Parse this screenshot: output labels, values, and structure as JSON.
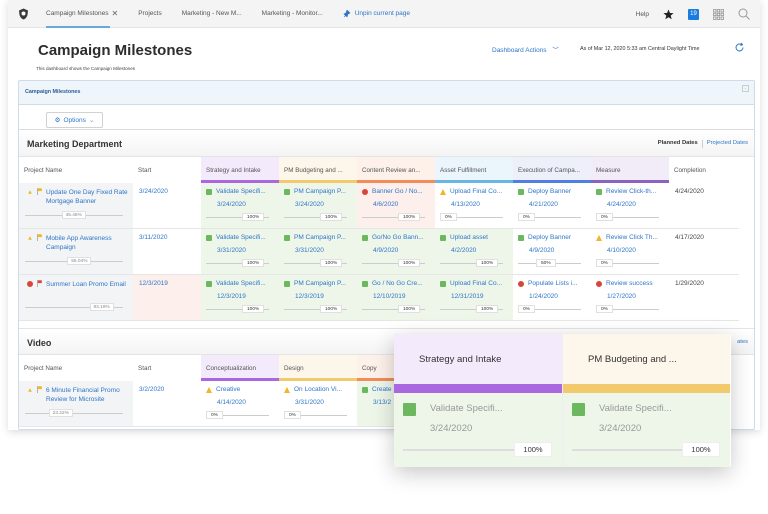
{
  "topbar": {
    "tabs": [
      {
        "label": "Campaign Milestones",
        "active": true,
        "closable": true
      },
      {
        "label": "Projects"
      },
      {
        "label": "Marketing - New M..."
      },
      {
        "label": "Marketing - Monitor..."
      }
    ],
    "unpin_label": "Unpin current page",
    "help_label": "Help",
    "notification_count": "19",
    "icons": [
      "logo-icon",
      "pin-icon",
      "star-icon",
      "apps-grid-icon",
      "search-icon"
    ]
  },
  "header": {
    "title": "Campaign Milestones",
    "subtitle": "This dashboard shows the Campaign Milestones",
    "dashboard_actions": "Dashboard Actions",
    "as_of": "As of  Mar 12, 2020 5:33 am Central Daylight Time"
  },
  "panel": {
    "title": "Campaign Milestones",
    "options_label": "Options"
  },
  "marketing": {
    "title": "Marketing Department",
    "planned_dates": "Planned Dates",
    "projected_dates": "Projected Dates",
    "columns": [
      {
        "label": "Project Name"
      },
      {
        "label": "Start"
      },
      {
        "label": "Strategy and Intake",
        "bg": "#f3eafb",
        "bar": "#a968e0"
      },
      {
        "label": "PM Budgeting and ...",
        "bg": "#fdf6ea",
        "bar": "#f2c96b"
      },
      {
        "label": "Content Review an...",
        "bg": "#fdf1ea",
        "bar": "#f08d58"
      },
      {
        "label": "Asset Fulfillment",
        "bg": "#eaf5fc",
        "bar": "#67b6e4"
      },
      {
        "label": "Execution of Campa...",
        "bg": "#edf0fb",
        "bar": "#4f7fe0"
      },
      {
        "label": "Measure",
        "bg": "#f1ecf7",
        "bar": "#8c62bf"
      },
      {
        "label": "Completion"
      }
    ],
    "rows": [
      {
        "name": "Update One Day Fixed Rate Mortgage Banner",
        "status": "warning",
        "progress": "45.45%",
        "start": "3/24/2020",
        "start_late": false,
        "milestones": [
          {
            "task": "Validate Specifi...",
            "date": "3/24/2020",
            "pct": "100%",
            "status": "done"
          },
          {
            "task": "PM Campaign P...",
            "date": "3/24/2020",
            "pct": "100%",
            "status": "done"
          },
          {
            "task": "Banner Go / No...",
            "date": "4/6/2020",
            "pct": "100%",
            "status": "late"
          },
          {
            "task": "Upload Final Co...",
            "date": "4/13/2020",
            "pct": "0%",
            "status": "warning"
          },
          {
            "task": "Deploy Banner",
            "date": "4/21/2020",
            "pct": "0%",
            "status": "ontrack"
          },
          {
            "task": "Review Click-th...",
            "date": "4/24/2020",
            "pct": "0%",
            "status": "ontrack"
          }
        ],
        "completion": "4/24/2020"
      },
      {
        "name": "Mobile App Awareness Campaign",
        "status": "warning",
        "progress": "55.04%",
        "start": "3/11/2020",
        "start_late": false,
        "milestones": [
          {
            "task": "Validate Specifi...",
            "date": "3/31/2020",
            "pct": "100%",
            "status": "done"
          },
          {
            "task": "PM Campaign P...",
            "date": "3/31/2020",
            "pct": "100%",
            "status": "done"
          },
          {
            "task": "Go/No Go Bann...",
            "date": "4/9/2020",
            "pct": "100%",
            "status": "done"
          },
          {
            "task": "Upload asset",
            "date": "4/2/2020",
            "pct": "100%",
            "status": "done"
          },
          {
            "task": "Deploy Banner",
            "date": "4/9/2020",
            "pct": "50%",
            "status": "ontrack"
          },
          {
            "task": "Review Click Th...",
            "date": "4/10/2020",
            "pct": "0%",
            "status": "warning"
          }
        ],
        "completion": "4/17/2020"
      },
      {
        "name": "Summer Loan Promo Email",
        "status": "late",
        "progress": "93.18%",
        "start": "12/3/2019",
        "start_late": true,
        "milestones": [
          {
            "task": "Validate Specifi...",
            "date": "12/3/2019",
            "pct": "100%",
            "status": "done"
          },
          {
            "task": "PM Campaign P...",
            "date": "12/3/2019",
            "pct": "100%",
            "status": "done"
          },
          {
            "task": "Go / No Go Cre...",
            "date": "12/10/2019",
            "pct": "100%",
            "status": "done"
          },
          {
            "task": "Upload Final Co...",
            "date": "12/31/2019",
            "pct": "100%",
            "status": "done"
          },
          {
            "task": "Populate Lists i...",
            "date": "1/24/2020",
            "pct": "0%",
            "status": "late-nobg"
          },
          {
            "task": "Review success",
            "date": "1/27/2020",
            "pct": "0%",
            "status": "late-nobg"
          }
        ],
        "completion": "1/29/2020"
      }
    ]
  },
  "video": {
    "title": "Video",
    "projected_dates_partial": "ates",
    "columns": [
      {
        "label": "Project Name"
      },
      {
        "label": "Start"
      },
      {
        "label": "Conceptualization",
        "bg": "#f3eafb",
        "bar": "#a968e0"
      },
      {
        "label": "Design",
        "bg": "#fdf6ea",
        "bar": "#f2c96b"
      },
      {
        "label": "Copy",
        "bg": "#fdf1ea",
        "bar": "#f08d58"
      }
    ],
    "rows": [
      {
        "name": "6 Minute Financial Promo Review for Microsite",
        "status": "warning",
        "progress": "23.22%",
        "start": "3/2/2020",
        "milestones": [
          {
            "task": "Creative",
            "date": "4/14/2020",
            "pct": "0%",
            "status": "warning"
          },
          {
            "task": "On Location Vi...",
            "date": "3/31/2020",
            "pct": "0%",
            "status": "warning"
          },
          {
            "task": "Create",
            "date": "3/13/2",
            "pct": "",
            "status": "done"
          }
        ]
      }
    ]
  },
  "zoom_card": {
    "columns": [
      {
        "label": "Strategy and Intake",
        "bg": "#f3eafb",
        "bar": "#a968e0",
        "task": "Validate Specifi...",
        "date": "3/24/2020",
        "pct": "100%"
      },
      {
        "label": "PM Budgeting and ...",
        "bg": "#fdf6ea",
        "bar": "#f2c96b",
        "task": "Validate Specifi...",
        "date": "3/24/2020",
        "pct": "100%"
      }
    ]
  }
}
